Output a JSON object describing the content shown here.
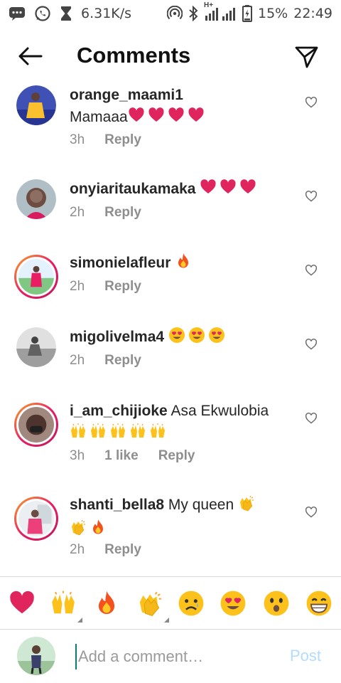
{
  "status_bar": {
    "speed": "6.31K/s",
    "network_type": "H+",
    "battery": "15%",
    "time": "22:49",
    "icons": [
      "message-icon",
      "whatsapp-icon",
      "hourglass-icon",
      "hotspot-icon",
      "bluetooth-icon",
      "signal-icon",
      "battery-icon"
    ]
  },
  "header": {
    "title": "Comments",
    "back_icon": "back-arrow-icon",
    "share_icon": "direct-send-icon"
  },
  "comments": [
    {
      "username": "orange_maami1",
      "text": "Mamaaa",
      "emojis": [
        "heart",
        "heart",
        "heart",
        "heart"
      ],
      "emoji_inline": false,
      "time": "3h",
      "likes": "",
      "reply": "Reply",
      "ring": false
    },
    {
      "username": "onyiaritaukamaka",
      "text": "",
      "emojis": [
        "heart",
        "heart",
        "heart"
      ],
      "emoji_inline": true,
      "time": "2h",
      "likes": "",
      "reply": "Reply",
      "ring": false
    },
    {
      "username": "simonielafleur",
      "text": "",
      "emojis": [
        "fire"
      ],
      "emoji_inline": true,
      "time": "2h",
      "likes": "",
      "reply": "Reply",
      "ring": true
    },
    {
      "username": "migolivelma4",
      "text": "",
      "emojis": [
        "heart-eyes",
        "heart-eyes",
        "heart-eyes"
      ],
      "emoji_inline": true,
      "time": "2h",
      "likes": "",
      "reply": "Reply",
      "ring": false
    },
    {
      "username": "i_am_chijioke",
      "text": "Asa Ekwulobia",
      "emojis": [
        "raised-hands",
        "raised-hands",
        "raised-hands",
        "raised-hands",
        "raised-hands"
      ],
      "emoji_inline": false,
      "time": "3h",
      "likes": "1 like",
      "reply": "Reply",
      "ring": true
    },
    {
      "username": "shanti_bella8",
      "text": "My queen",
      "emojis": [
        "clap",
        "clap",
        "fire"
      ],
      "emoji_inline": false,
      "time": "2h",
      "likes": "",
      "reply": "Reply",
      "ring": true
    }
  ],
  "emoji_bar": [
    "heart",
    "raised-hands",
    "fire",
    "clap",
    "sad",
    "heart-eyes",
    "surprised",
    "grinning"
  ],
  "composer": {
    "placeholder": "Add a comment…",
    "post_label": "Post"
  },
  "colors": {
    "heart": "#e0245e",
    "post_disabled": "#b3dbff",
    "meta_gray": "#8e8e8e",
    "story_ring": "#e91e63"
  }
}
